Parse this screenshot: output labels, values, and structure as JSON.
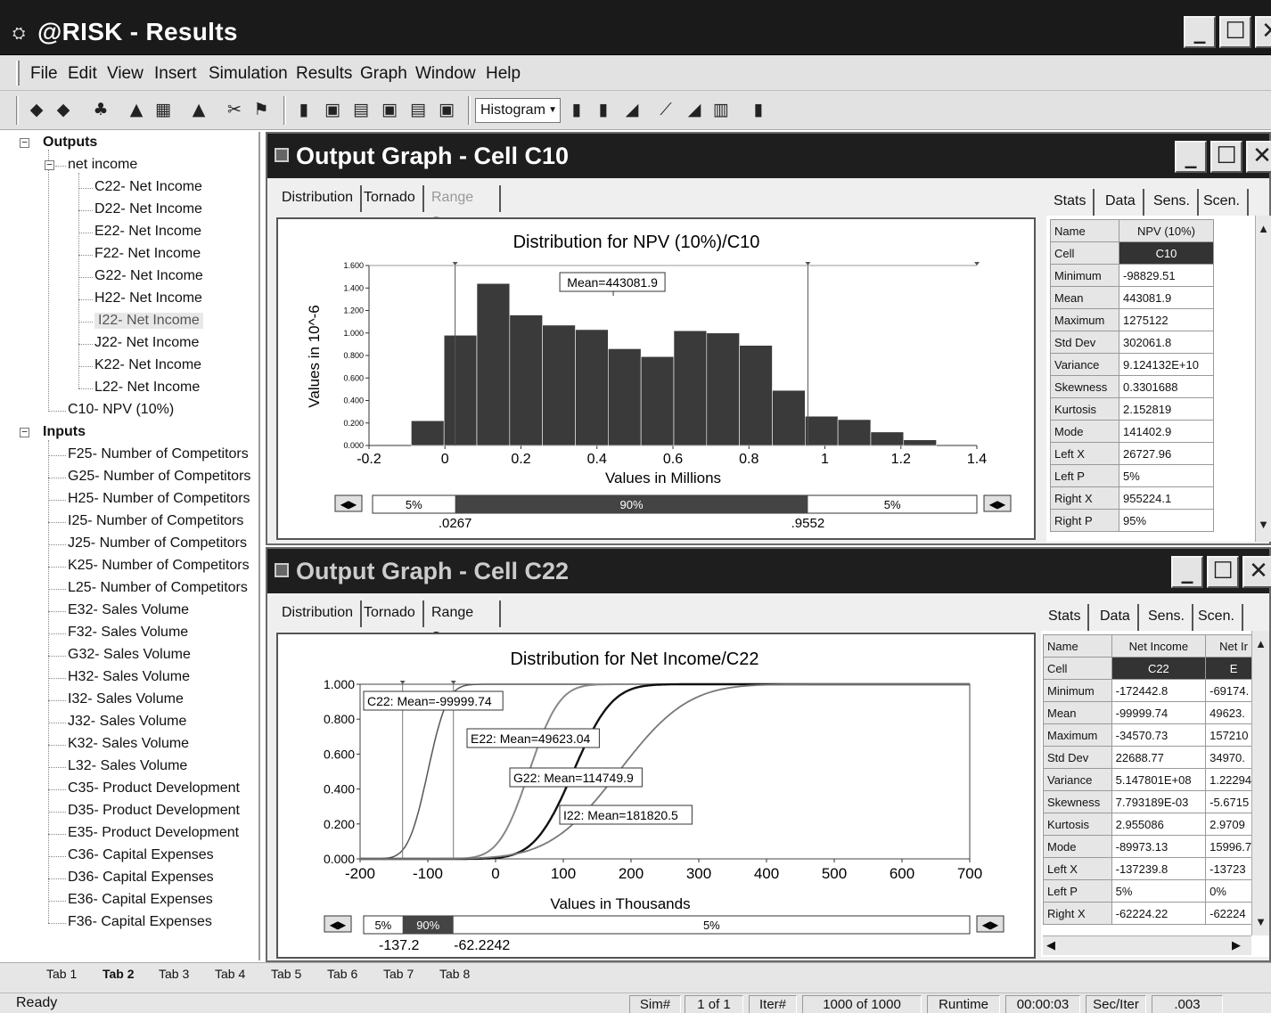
{
  "app": {
    "title": "@RISK - Results"
  },
  "window_buttons": {
    "minimize": "_",
    "maximize": "☐",
    "close": "✕"
  },
  "menu": [
    "File",
    "Edit",
    "View",
    "Insert",
    "Simulation",
    "Results",
    "Graph",
    "Window",
    "Help"
  ],
  "toolbar": {
    "graph_type": "Histogram"
  },
  "tree": {
    "outputs_label": "Outputs",
    "net_income_label": "net income",
    "net_income_items": [
      "C22- Net Income",
      "D22- Net Income",
      "E22- Net Income",
      "F22- Net Income",
      "G22- Net Income",
      "H22- Net Income",
      "I22- Net Income",
      "J22- Net Income",
      "K22- Net Income",
      "L22- Net Income"
    ],
    "npv_item": "C10- NPV (10%)",
    "inputs_label": "Inputs",
    "inputs": [
      "F25- Number of Competitors",
      "G25- Number of Competitors",
      "H25- Number of Competitors",
      "I25- Number of Competitors",
      "J25- Number of Competitors",
      "K25- Number of Competitors",
      "L25- Number of Competitors",
      "E32- Sales Volume",
      "F32- Sales Volume",
      "G32- Sales Volume",
      "H32- Sales Volume",
      "I32- Sales Volume",
      "J32- Sales Volume",
      "K32- Sales Volume",
      "L32- Sales Volume",
      "C35- Product Development",
      "D35- Product Development",
      "E35- Product Development",
      "C36- Capital Expenses",
      "D36- Capital Expenses",
      "E36- Capital Expenses",
      "F36- Capital Expenses"
    ]
  },
  "window1": {
    "title": "Output Graph - Cell C10",
    "tabs": [
      "Distribution",
      "Tornado",
      "Range Summary"
    ],
    "stats_tabs": [
      "Stats",
      "Data",
      "Sens.",
      "Scen."
    ],
    "stats_header": [
      "Name",
      "NPV (10%)"
    ],
    "stats_rows": [
      [
        "Cell",
        "C10"
      ],
      [
        "Minimum",
        "-98829.51"
      ],
      [
        "Mean",
        "443081.9"
      ],
      [
        "Maximum",
        "1275122"
      ],
      [
        "Std Dev",
        "302061.8"
      ],
      [
        "Variance",
        "9.124132E+10"
      ],
      [
        "Skewness",
        "0.3301688"
      ],
      [
        "Kurtosis",
        "2.152819"
      ],
      [
        "Mode",
        "141402.9"
      ],
      [
        "Left X",
        "26727.96"
      ],
      [
        "Left P",
        "5%"
      ],
      [
        "Right X",
        "955224.1"
      ],
      [
        "Right P",
        "95%"
      ]
    ],
    "range": {
      "left_pct": "5%",
      "mid_pct": "90%",
      "right_pct": "5%",
      "left_val": ".0267",
      "right_val": ".9552"
    }
  },
  "window2": {
    "title": "Output Graph - Cell C22",
    "tabs": [
      "Distribution",
      "Tornado",
      "Range Summary"
    ],
    "stats_tabs": [
      "Stats",
      "Data",
      "Sens.",
      "Scen."
    ],
    "stats_header": [
      "Name",
      "Net Income",
      "Net Ir"
    ],
    "stats_rows": [
      [
        "Cell",
        "C22",
        "E"
      ],
      [
        "Minimum",
        "-172442.8",
        "-69174."
      ],
      [
        "Mean",
        "-99999.74",
        "49623."
      ],
      [
        "Maximum",
        "-34570.73",
        "157210"
      ],
      [
        "Std Dev",
        "22688.77",
        "34970."
      ],
      [
        "Variance",
        "5.147801E+08",
        "1.22294"
      ],
      [
        "Skewness",
        "7.793189E-03",
        "-5.6715"
      ],
      [
        "Kurtosis",
        "2.955086",
        "2.9709"
      ],
      [
        "Mode",
        "-89973.13",
        "15996.7"
      ],
      [
        "Left X",
        "-137239.8",
        "-13723"
      ],
      [
        "Left P",
        "5%",
        "0%"
      ],
      [
        "Right X",
        "-62224.22",
        "-62224"
      ]
    ],
    "range": {
      "left_pct": "5%",
      "mid_pct": "90%",
      "right_pct": "5%",
      "left_val": "-137.2",
      "right_val": "-62.2242"
    }
  },
  "chart_data": [
    {
      "type": "bar",
      "title": "Distribution for NPV (10%)/C10",
      "xlabel": "Values in Millions",
      "ylabel": "Values in 10^-6",
      "xlim": [
        -0.2,
        1.4
      ],
      "ylim": [
        0,
        1.6
      ],
      "xticks": [
        "-0.2",
        "0",
        "0.2",
        "0.4",
        "0.6",
        "0.8",
        "1",
        "1.2",
        "1.4"
      ],
      "yticks": [
        "0.000",
        "0.200",
        "0.400",
        "0.600",
        "0.800",
        "1.000",
        "1.200",
        "1.400",
        "1.600"
      ],
      "bins": [
        -0.0889,
        -0.0025,
        0.0839,
        0.1703,
        0.2567,
        0.3431,
        0.4295,
        0.5159,
        0.6023,
        0.6887,
        0.7751,
        0.8615,
        0.9479,
        1.0343,
        1.1207,
        1.2071
      ],
      "values": [
        0.22,
        0.98,
        1.44,
        1.16,
        1.07,
        1.03,
        0.86,
        0.79,
        1.02,
        1.0,
        0.89,
        0.49,
        0.26,
        0.23,
        0.12,
        0.05
      ],
      "annotation": "Mean=443081.9",
      "mean": 0.443,
      "markers": [
        0.0267,
        0.9552
      ]
    },
    {
      "type": "line",
      "title": "Distribution for Net Income/C22",
      "xlabel": "Values in Thousands",
      "xlim": [
        -200,
        700
      ],
      "ylim": [
        0,
        1
      ],
      "xticks": [
        "-200",
        "-100",
        "0",
        "100",
        "200",
        "300",
        "400",
        "500",
        "600",
        "700"
      ],
      "yticks": [
        "0.000",
        "0.200",
        "0.400",
        "0.600",
        "0.800",
        "1.000"
      ],
      "series": [
        {
          "mean": -99.99974,
          "sd": 22.7,
          "annotation": "C22: Mean=-99999.74"
        },
        {
          "mean": 49.62304,
          "sd": 35,
          "annotation": "E22: Mean=49623.04"
        },
        {
          "mean": 114.7499,
          "sd": 45,
          "annotation": "G22: Mean=114749.9"
        },
        {
          "mean": 181.8205,
          "sd": 80,
          "annotation": "I22: Mean=181820.5"
        }
      ],
      "markers": [
        -137.2398,
        -62.22422
      ]
    }
  ],
  "sheet_tabs": [
    "Tab 1",
    "Tab 2",
    "Tab 3",
    "Tab 4",
    "Tab 5",
    "Tab 6",
    "Tab 7",
    "Tab 8"
  ],
  "status": {
    "ready": "Ready",
    "sim_label": "Sim#",
    "sim_val": "1 of 1",
    "iter_label": "Iter#",
    "iter_val": "1000 of 1000",
    "runtime_label": "Runtime",
    "runtime_val": "00:00:03",
    "seciter_label": "Sec/Iter",
    "seciter_val": ".003"
  }
}
